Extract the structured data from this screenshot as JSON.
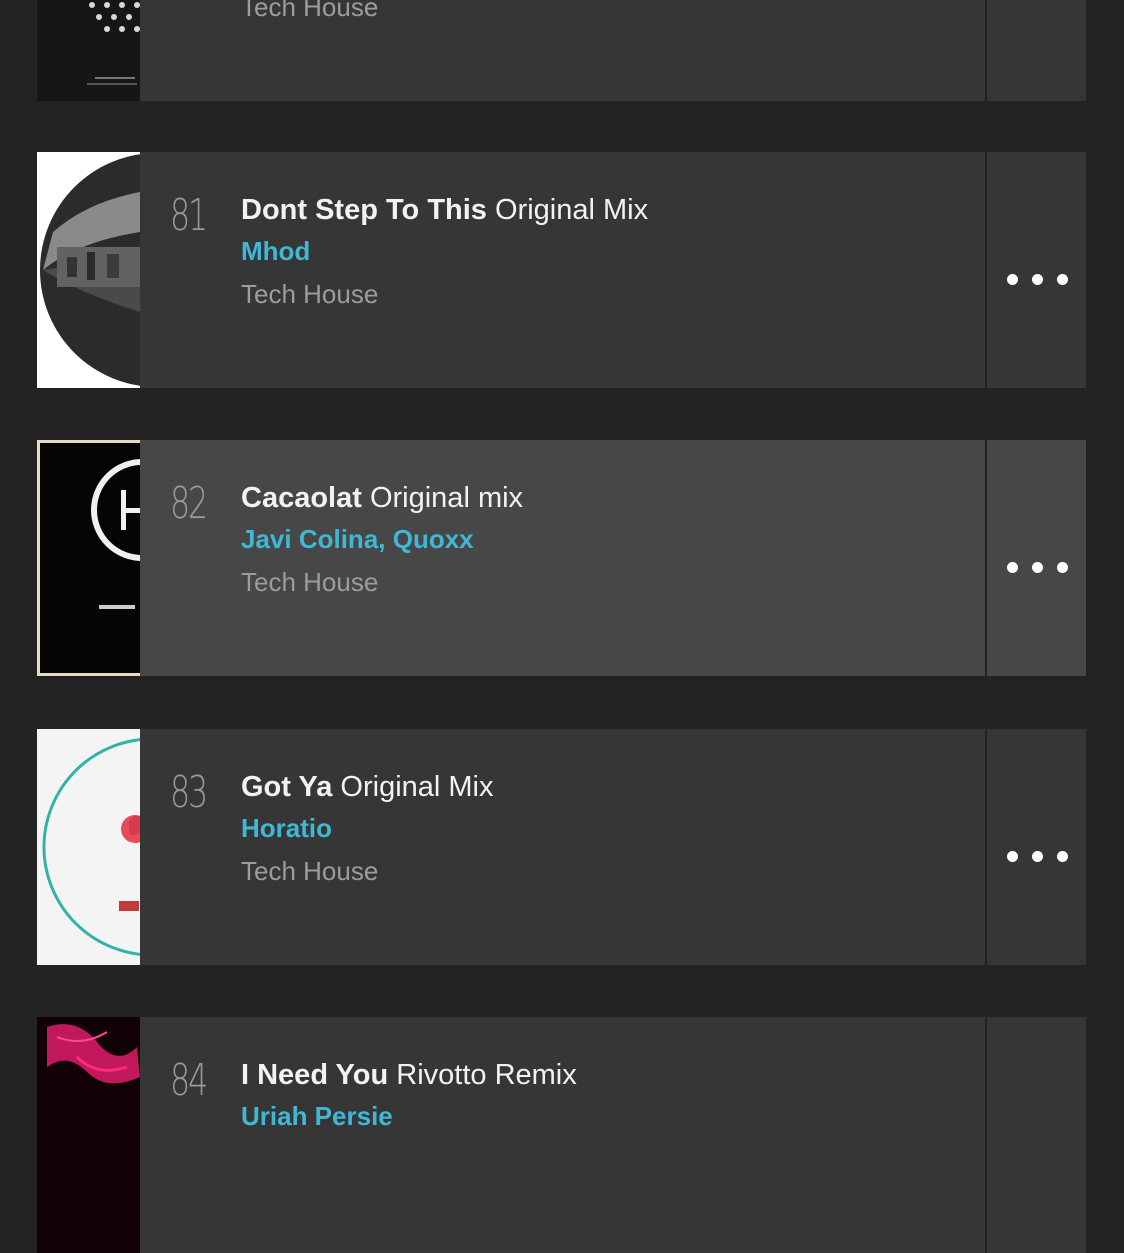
{
  "tracks": [
    {
      "rank": "",
      "title": "",
      "mix": "",
      "artist": "",
      "genre": "Tech House"
    },
    {
      "rank": "81",
      "title": "Dont Step To This",
      "mix": "Original Mix",
      "artist": "Mhod",
      "genre": "Tech House"
    },
    {
      "rank": "82",
      "title": "Cacaolat",
      "mix": "Original mix",
      "artist": "Javi Colina, Quoxx",
      "genre": "Tech House"
    },
    {
      "rank": "83",
      "title": "Got Ya",
      "mix": "Original Mix",
      "artist": "Horatio",
      "genre": "Tech House"
    },
    {
      "rank": "84",
      "title": "I Need You",
      "mix": "Rivotto Remix",
      "artist": "Uriah Persie",
      "genre": ""
    }
  ],
  "colors": {
    "background": "#232323",
    "row": "#363636",
    "row_highlight": "#474747",
    "artist": "#3fb8d6",
    "genre": "#9c9c9c"
  },
  "icons": {
    "more": "more-dots-icon"
  }
}
